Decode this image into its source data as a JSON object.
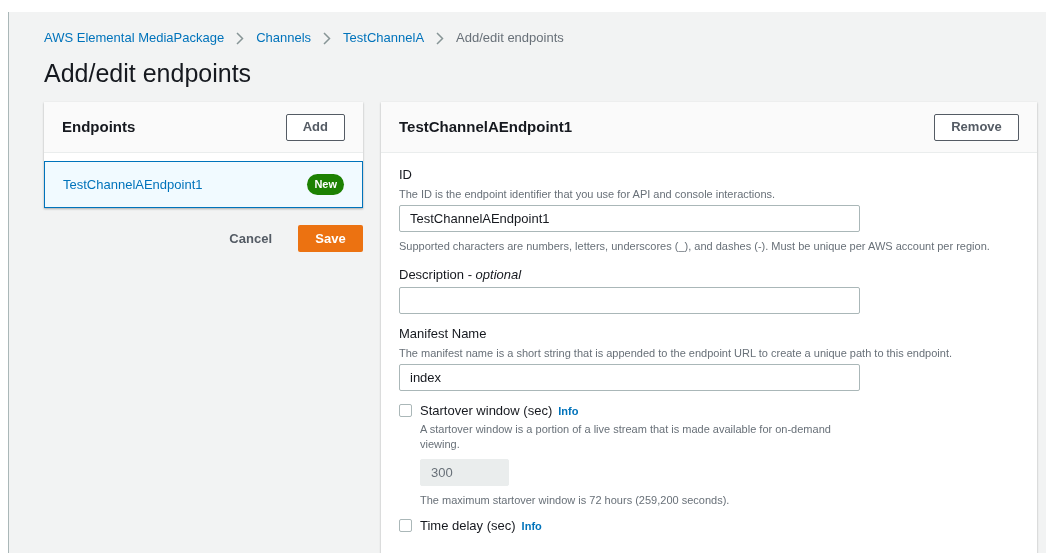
{
  "breadcrumbs": [
    {
      "label": "AWS Elemental MediaPackage",
      "link": true
    },
    {
      "label": "Channels",
      "link": true
    },
    {
      "label": "TestChannelA",
      "link": true
    },
    {
      "label": "Add/edit endpoints",
      "link": false
    }
  ],
  "title": "Add/edit endpoints",
  "endpoints_panel": {
    "title": "Endpoints",
    "add_button": "Add",
    "items": [
      {
        "name": "TestChannelAEndpoint1",
        "badge": "New",
        "selected": true
      }
    ],
    "cancel_button": "Cancel",
    "save_button": "Save"
  },
  "detail_panel": {
    "title": "TestChannelAEndpoint1",
    "remove_button": "Remove",
    "fields": [
      {
        "kind": "input",
        "label": "ID",
        "description": "The ID is the endpoint identifier that you use for API and console interactions.",
        "value": "TestChannelAEndpoint1",
        "hint": "Supported characters are numbers, letters, underscores (_), and dashes (-). Must be unique per AWS account per region."
      },
      {
        "kind": "input",
        "label": "Description - *optional*"
      },
      {
        "kind": "input",
        "label": "Manifest Name",
        "description": "The manifest name is a short string that is appended to the endpoint URL to create a unique path to this endpoint.",
        "value": "index"
      },
      {
        "kind": "checkbox",
        "label": "Startover window (sec)",
        "info": "Info",
        "checked": false,
        "description": "A startover window is a portion of a live stream that is made available for on-demand viewing.",
        "value": "300",
        "disabled": true,
        "hint": "The maximum startover window is 72 hours (259,200 seconds)."
      },
      {
        "kind": "checkbox",
        "label": "Time delay (sec)",
        "info": "Info",
        "checked": false
      }
    ]
  }
}
